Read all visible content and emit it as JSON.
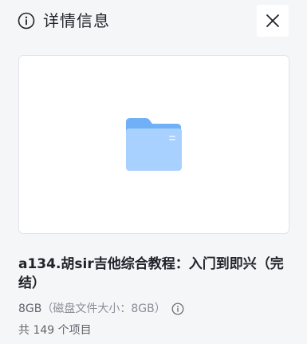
{
  "header": {
    "title": "详情信息",
    "info_icon": "info-circle-icon",
    "close_icon": "close-icon"
  },
  "preview": {
    "icon": "folder-icon"
  },
  "file": {
    "name": "a134.胡sir吉他综合教程：入门到即兴（完结）",
    "size": "8GB",
    "size_detail": "（磁盘文件大小：8GB）",
    "size_info_icon": "info-circle-icon",
    "item_count": "共 149 个项目"
  },
  "colors": {
    "background": "#f5f6f8",
    "card": "#ffffff",
    "folder_light": "#a8d1ff",
    "folder_dark": "#6fb0f7"
  }
}
